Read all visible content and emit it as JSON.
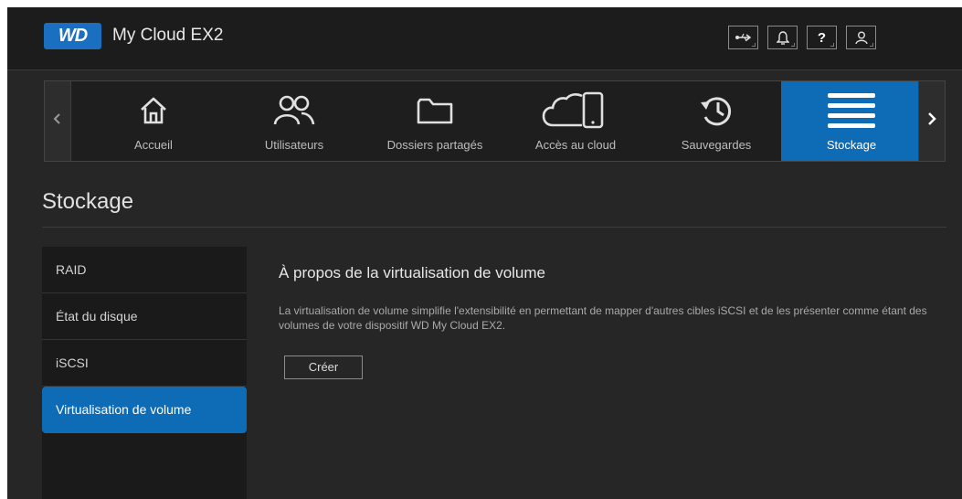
{
  "header": {
    "logo_text": "WD",
    "app_title": "My Cloud EX2",
    "buttons": [
      {
        "icon": "usb-icon"
      },
      {
        "icon": "bell-icon"
      },
      {
        "icon": "help-icon",
        "label": "?"
      },
      {
        "icon": "user-icon"
      }
    ]
  },
  "nav": {
    "items": [
      {
        "label": "Accueil",
        "icon": "home-icon"
      },
      {
        "label": "Utilisateurs",
        "icon": "users-icon"
      },
      {
        "label": "Dossiers partagés",
        "icon": "folder-icon"
      },
      {
        "label": "Accès au cloud",
        "icon": "cloud-device-icon"
      },
      {
        "label": "Sauvegardes",
        "icon": "history-icon"
      },
      {
        "label": "Stockage",
        "icon": "storage-icon",
        "active": true
      }
    ]
  },
  "page": {
    "title": "Stockage"
  },
  "sidemenu": {
    "items": [
      {
        "label": "RAID"
      },
      {
        "label": "État du disque"
      },
      {
        "label": "iSCSI"
      },
      {
        "label": "Virtualisation de volume",
        "active": true
      }
    ]
  },
  "content": {
    "title": "À propos de la virtualisation de volume",
    "description": "La virtualisation de volume simplifie l'extensibilité en permettant de mapper d'autres cibles iSCSI et de les présenter comme étant des volumes de votre dispositif WD My Cloud EX2.",
    "create_label": "Créer"
  },
  "colors": {
    "accent": "#0d6cb5",
    "background": "#262626",
    "header": "#1c1c1c"
  }
}
